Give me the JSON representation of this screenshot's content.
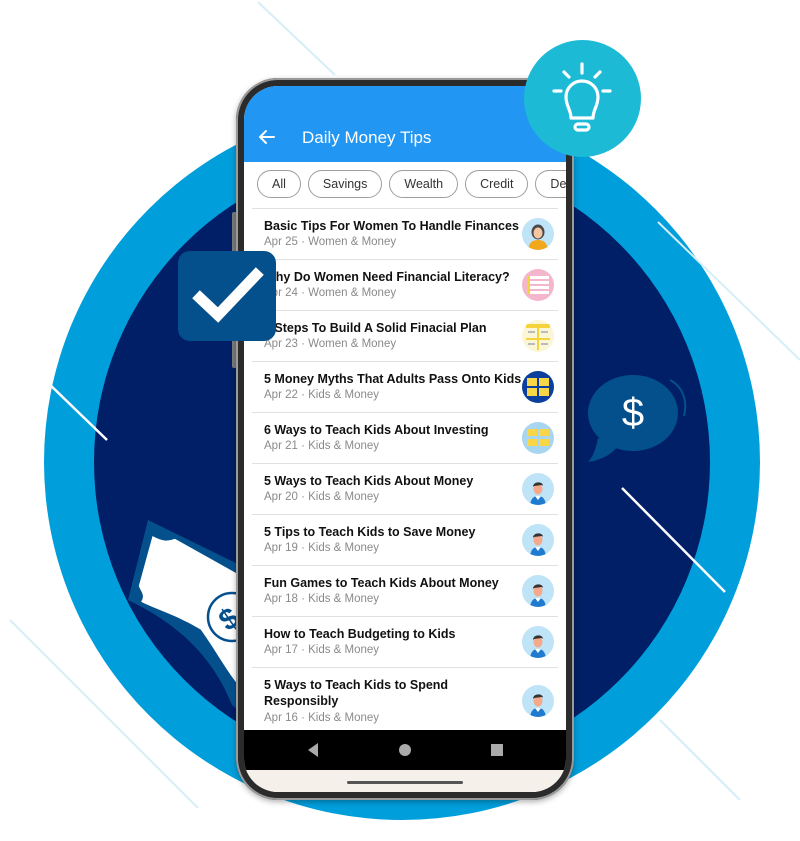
{
  "app": {
    "title": "Daily Money Tips",
    "back_icon": "arrow-left-icon"
  },
  "chips": [
    {
      "label": "All"
    },
    {
      "label": "Savings"
    },
    {
      "label": "Wealth"
    },
    {
      "label": "Credit"
    },
    {
      "label": "Debt"
    }
  ],
  "articles": [
    {
      "title": "Basic Tips For Women To Handle Finances",
      "date": "Apr 25",
      "category": "Women & Money",
      "meta": "Apr 25 · Women & Money",
      "thumb": "woman-avatar"
    },
    {
      "title": "Why Do Women Need Financial Literacy?",
      "date": "Apr 24",
      "category": "Women & Money",
      "meta": "Apr 24 · Women & Money",
      "thumb": "pink-infographic"
    },
    {
      "title": "7 Steps To Build A Solid Finacial Plan",
      "date": "Apr 23",
      "category": "Women & Money",
      "meta": "Apr 23 · Women & Money",
      "thumb": "yellow-infographic"
    },
    {
      "title": "5 Money Myths That Adults Pass Onto Kids",
      "date": "Apr 22",
      "category": "Kids & Money",
      "meta": "Apr 22 · Kids & Money",
      "thumb": "navy-infographic"
    },
    {
      "title": "6 Ways to Teach Kids About Investing",
      "date": "Apr 21",
      "category": "Kids & Money",
      "meta": "Apr 21 · Kids & Money",
      "thumb": "lightblue-infographic"
    },
    {
      "title": "5 Ways to Teach Kids About Money",
      "date": "Apr 20",
      "category": "Kids & Money",
      "meta": "Apr 20 · Kids & Money",
      "thumb": "man-avatar"
    },
    {
      "title": "5 Tips to Teach Kids to Save Money",
      "date": "Apr 19",
      "category": "Kids & Money",
      "meta": "Apr 19 · Kids & Money",
      "thumb": "man-avatar"
    },
    {
      "title": "Fun Games to Teach Kids About Money",
      "date": "Apr 18",
      "category": "Kids & Money",
      "meta": "Apr 18 · Kids & Money",
      "thumb": "man-avatar"
    },
    {
      "title": "How to Teach Budgeting to Kids",
      "date": "Apr 17",
      "category": "Kids & Money",
      "meta": "Apr 17 · Kids & Money",
      "thumb": "man-avatar"
    },
    {
      "title": "5 Ways to Teach Kids to Spend Responsibly",
      "date": "Apr 16",
      "category": "Kids & Money",
      "meta": "Apr 16 · Kids & Money",
      "thumb": "man-avatar"
    }
  ],
  "navbar": {
    "back": "nav-back-icon",
    "home": "nav-home-icon",
    "recents": "nav-recents-icon"
  },
  "decorations": {
    "bulb": "lightbulb-icon",
    "check": "checkmark-icon",
    "dollar": "dollar-bubble-icon",
    "note": "banknote-icon"
  },
  "colors": {
    "appbar": "#2196F3",
    "ring_outer": "#009EDB",
    "ring_inner": "#001F66",
    "bulb_badge": "#1DBAD6",
    "check_badge": "#04508D"
  }
}
